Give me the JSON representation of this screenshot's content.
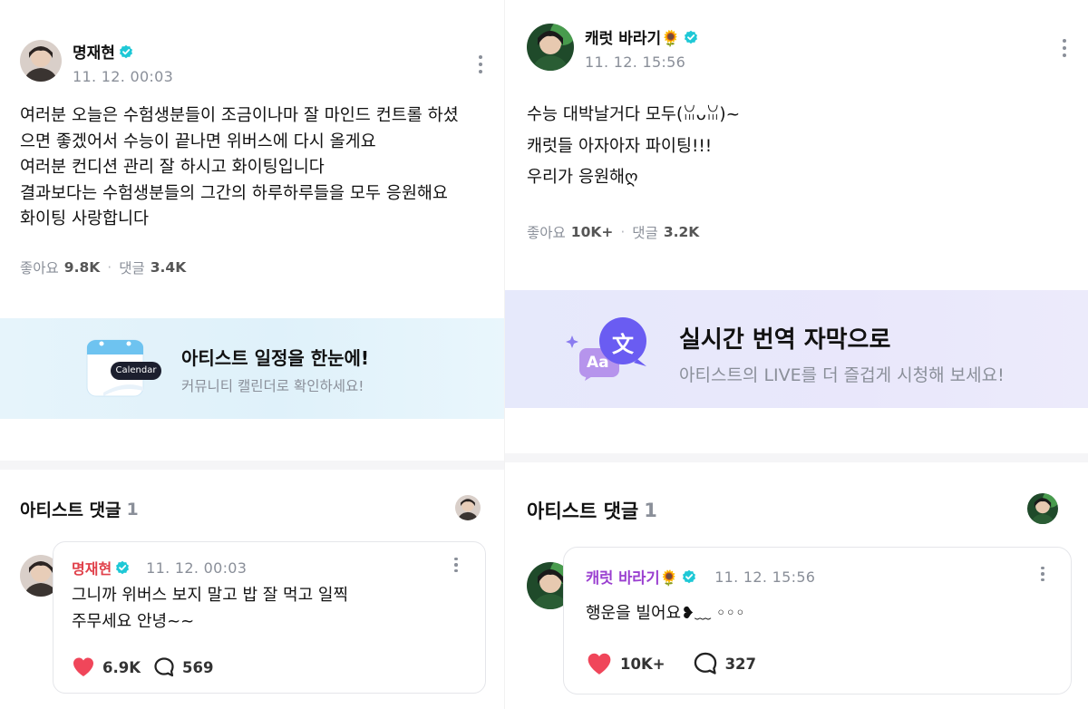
{
  "colors": {
    "verified": "#1ec8d6",
    "heart": "#f0465a",
    "left_comment_name": "#e0404a",
    "right_comment_name": "#9a3fd0",
    "banner_left_bg": "#e4f4fb",
    "banner_right_bg": "#e9e8fb"
  },
  "left": {
    "post": {
      "author": "명재현",
      "timestamp": "11. 12. 00:03",
      "body": "여러분 오늘은 수험생분들이 조금이나마 잘 마인드 컨트롤 하셨\n으면 좋겠어서 수능이 끝나면 위버스에 다시 올게요\n여러분 컨디션 관리 잘 하시고 화이팅입니다\n결과보다는 수험생분들의 그간의 하루하루들을 모두 응원해요\n화이팅 사랑합니다",
      "likes_label": "좋아요",
      "likes": "9.8K",
      "comments_label": "댓글",
      "comments": "3.4K"
    },
    "banner": {
      "icon": "calendar-icon",
      "icon_label": "Calendar",
      "title": "아티스트 일정을 한눈에!",
      "subtitle": "커뮤니티 캘린더로 확인하세요!"
    },
    "artist_comments": {
      "title": "아티스트 댓글",
      "count": "1"
    },
    "comment": {
      "author": "명재현",
      "timestamp": "11. 12. 00:03",
      "text": "그니까 위버스 보지 말고 밥 잘 먹고 일찍\n주무세요 안녕~~",
      "likes": "6.9K",
      "replies": "569"
    }
  },
  "right": {
    "post": {
      "author": "캐럿 바라기🌻",
      "timestamp": "11. 12. 15:56",
      "body": "수능 대박날거다 모두(ꈍᴗꈍ)~\n캐럿들 아자아자 파이팅!!!\n우리가 응원해ღ",
      "likes_label": "좋아요",
      "likes": "10K+",
      "comments_label": "댓글",
      "comments": "3.2K"
    },
    "banner": {
      "icon": "translate-icon",
      "icon_glyph_main": "文",
      "icon_glyph_sub": "Aa",
      "title": "실시간 번역 자막으로",
      "subtitle": "아티스트의 LIVE를 더 즐겁게 시청해 보세요!"
    },
    "artist_comments": {
      "title": "아티스트 댓글",
      "count": "1"
    },
    "comment": {
      "author": "캐럿 바라기🌻",
      "timestamp": "11. 12. 15:56",
      "text": "행운을 빌어요❥﹏ ◦◦◦",
      "likes": "10K+",
      "replies": "327"
    }
  }
}
